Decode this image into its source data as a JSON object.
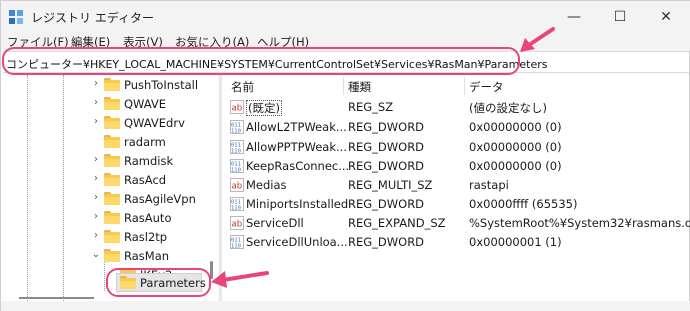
{
  "window": {
    "title": "レジストリ エディター",
    "controls": {
      "minimize": "—",
      "maximize": "☐",
      "close": "✕"
    }
  },
  "menu": [
    "ファイル(F)",
    "編集(E)",
    "表示(V)",
    "お気に入り(A)",
    "ヘルプ(H)"
  ],
  "address": "コンピューター¥HKEY_LOCAL_MACHINE¥SYSTEM¥CurrentControlSet¥Services¥RasMan¥Parameters",
  "tree": [
    {
      "label": "PushToInstall",
      "expand": "›"
    },
    {
      "label": "QWAVE",
      "expand": "›"
    },
    {
      "label": "QWAVEdrv",
      "expand": "›"
    },
    {
      "label": "radarm",
      "expand": ""
    },
    {
      "label": "Ramdisk",
      "expand": "›"
    },
    {
      "label": "RasAcd",
      "expand": "›"
    },
    {
      "label": "RasAgileVpn",
      "expand": "›"
    },
    {
      "label": "RasAuto",
      "expand": "›"
    },
    {
      "label": "Rasl2tp",
      "expand": "›"
    },
    {
      "label": "RasMan",
      "expand": "⌄"
    },
    {
      "label": "IKEv2",
      "expand": ""
    },
    {
      "label": "Parameters",
      "expand": ""
    }
  ],
  "columns": {
    "name": "名前",
    "type": "種類",
    "data": "データ"
  },
  "values": [
    {
      "icon": "string-value-icon",
      "name": "(既定)",
      "type": "REG_SZ",
      "data": "(値の設定なし)"
    },
    {
      "icon": "binary-value-icon",
      "name": "AllowL2TPWeak...",
      "type": "REG_DWORD",
      "data": "0x00000000 (0)"
    },
    {
      "icon": "binary-value-icon",
      "name": "AllowPPTPWeak...",
      "type": "REG_DWORD",
      "data": "0x00000000 (0)"
    },
    {
      "icon": "binary-value-icon",
      "name": "KeepRasConnec...",
      "type": "REG_DWORD",
      "data": "0x00000000 (0)"
    },
    {
      "icon": "string-value-icon",
      "name": "Medias",
      "type": "REG_MULTI_SZ",
      "data": "rastapi"
    },
    {
      "icon": "binary-value-icon",
      "name": "MiniportsInstalled",
      "type": "REG_DWORD",
      "data": "0x0000ffff (65535)"
    },
    {
      "icon": "string-value-icon",
      "name": "ServiceDll",
      "type": "REG_EXPAND_SZ",
      "data": "%SystemRoot%¥System32¥rasmans.dll"
    },
    {
      "icon": "binary-value-icon",
      "name": "ServiceDllUnloa...",
      "type": "REG_DWORD",
      "data": "0x00000001 (1)"
    }
  ],
  "colors": {
    "annotation": "#e8457a",
    "folder": "#f9c94e",
    "string_icon": "#c0392b",
    "binary_icon": "#3a6fc4"
  }
}
